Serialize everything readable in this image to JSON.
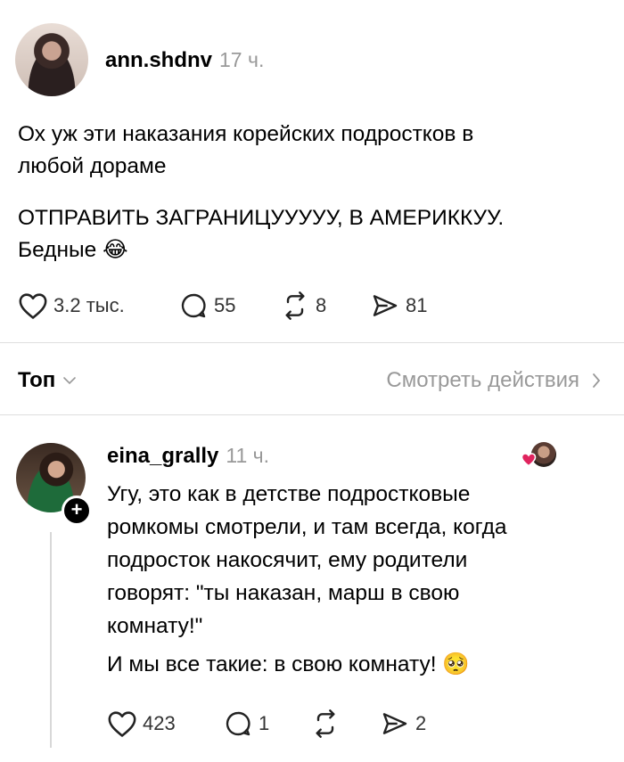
{
  "post": {
    "username": "ann.shdnv",
    "time": "17 ч.",
    "paragraph1_line1": "Ох уж эти наказания корейских подростков в",
    "paragraph1_line2": "любой дораме",
    "paragraph2_line1": "ОТПРАВИТЬ ЗАГРАНИЦУУУУУ, В АМЕРИККУУ.",
    "paragraph2_line2": "Бедные",
    "emoji": "😂",
    "likes": "3.2 тыс.",
    "replies": "55",
    "reposts": "8",
    "shares": "81"
  },
  "sort_bar": {
    "sort_label": "Топ",
    "activity_label": "Смотреть действия"
  },
  "reply": {
    "username": "eina_grally",
    "time": "11 ч.",
    "lines": [
      "Угу, это как в детстве подростковые",
      "ромкомы смотрели, и там всегда, когда",
      "подросток накосячит, ему родители",
      "говорят: \"ты наказан, марш в свою",
      "комнату!\"",
      "И мы все такие: в свою комнату!"
    ],
    "emoji": "🥺",
    "likes": "423",
    "replies": "1",
    "shares": "2"
  },
  "colors": {
    "text": "#000000",
    "muted": "#999999",
    "liked_heart": "#e0245e"
  }
}
